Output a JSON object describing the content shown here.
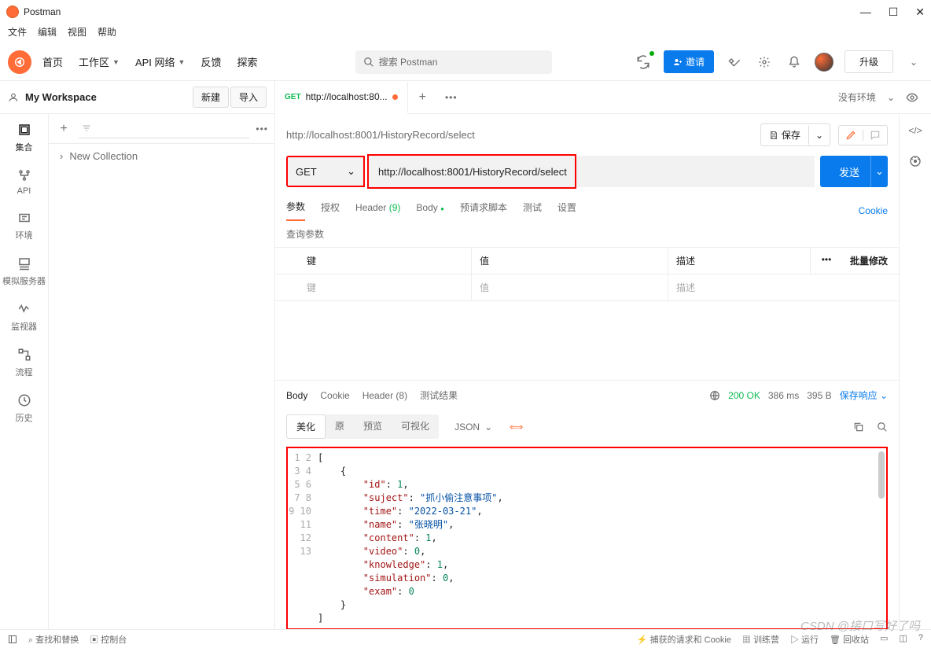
{
  "app": {
    "title": "Postman"
  },
  "menubar": [
    "文件",
    "编辑",
    "视图",
    "帮助"
  ],
  "topnav": {
    "home": "首页",
    "workspace": "工作区",
    "apinet": "API 网络",
    "feedback": "反馈",
    "explore": "探索",
    "search_placeholder": "搜索 Postman",
    "invite": "邀请",
    "upgrade": "升级"
  },
  "workspace": {
    "name": "My Workspace",
    "new_btn": "新建",
    "import_btn": "导入"
  },
  "tab": {
    "method": "GET",
    "title": "http://localhost:80..."
  },
  "env": {
    "none": "没有环境"
  },
  "rail": {
    "collections": "集合",
    "api": "API",
    "env": "环境",
    "mock": "模拟服务器",
    "monitor": "监视器",
    "flow": "流程",
    "history": "历史"
  },
  "sidebar": {
    "collection": "New Collection"
  },
  "request": {
    "title": "http://localhost:8001/HistoryRecord/select",
    "save": "保存",
    "method": "GET",
    "url": "http://localhost:8001/HistoryRecord/select",
    "send": "发送"
  },
  "subtabs": {
    "params": "参数",
    "auth": "授权",
    "headers": "Header (9)",
    "body": "Body",
    "prereq": "预请求脚本",
    "tests": "测试",
    "settings": "设置",
    "cookie": "Cookie"
  },
  "params": {
    "label": "查询参数",
    "key": "键",
    "value": "值",
    "desc": "描述",
    "bulk": "批量修改",
    "ph_key": "键",
    "ph_value": "值",
    "ph_desc": "描述"
  },
  "response": {
    "body": "Body",
    "cookie": "Cookie",
    "headers": "Header (8)",
    "tests": "测试结果",
    "status": "200 OK",
    "time": "386 ms",
    "size": "395 B",
    "save": "保存响应",
    "pretty": "美化",
    "raw": "原",
    "preview": "预览",
    "visual": "可视化",
    "format": "JSON"
  },
  "chart_data": {
    "type": "table",
    "rows": [
      {
        "id": 1,
        "suject": "抓小偷注意事项",
        "time": "2022-03-21",
        "name": "张晓明",
        "content": 1,
        "video": 0,
        "knowledge": 1,
        "simulation": 0,
        "exam": 0
      }
    ]
  },
  "footer": {
    "find": "查找和替换",
    "console": "控制台",
    "cookies": "捕获的请求和 Cookie",
    "boot": "训练营",
    "runner": "运行",
    "trash": "回收站"
  },
  "watermark": "CSDN @接口写好了吗"
}
